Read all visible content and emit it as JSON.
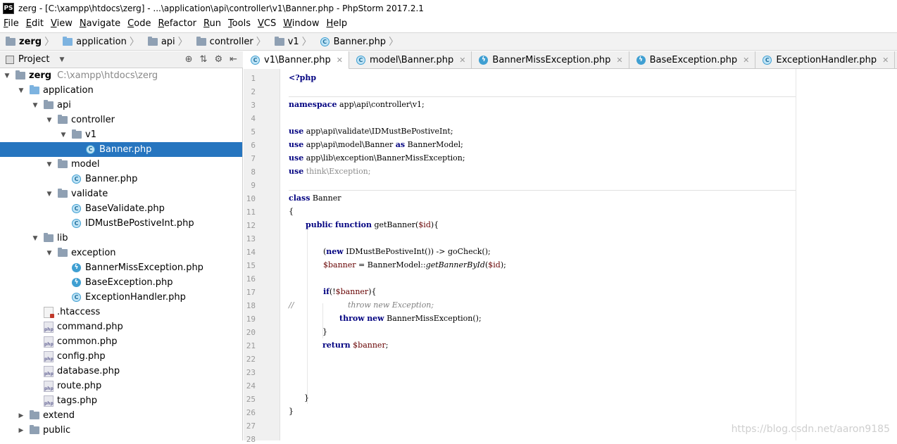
{
  "title_bar": {
    "logo": "PS",
    "title": "zerg - [C:\\xampp\\htdocs\\zerg] - ...\\application\\api\\controller\\v1\\Banner.php - PhpStorm 2017.2.1"
  },
  "menu": [
    {
      "label": "File",
      "u": "F",
      "rest": "ile"
    },
    {
      "label": "Edit",
      "u": "E",
      "rest": "dit"
    },
    {
      "label": "View",
      "u": "V",
      "rest": "iew"
    },
    {
      "label": "Navigate",
      "u": "N",
      "rest": "avigate"
    },
    {
      "label": "Code",
      "u": "C",
      "rest": "ode"
    },
    {
      "label": "Refactor",
      "u": "R",
      "rest": "efactor"
    },
    {
      "label": "Run",
      "u": "R",
      "rest": "un"
    },
    {
      "label": "Tools",
      "u": "T",
      "rest": "ools"
    },
    {
      "label": "VCS",
      "u": "V",
      "rest": "CS"
    },
    {
      "label": "Window",
      "u": "W",
      "rest": "indow"
    },
    {
      "label": "Help",
      "u": "H",
      "rest": "elp"
    }
  ],
  "breadcrumb": [
    "zerg",
    "application",
    "api",
    "controller",
    "v1",
    "Banner.php"
  ],
  "project_panel": {
    "label": "Project",
    "tools": [
      "⊕",
      "⇅",
      "⚙",
      "⇤"
    ]
  },
  "tree": [
    {
      "label": "zerg",
      "path": "C:\\xampp\\htdocs\\zerg",
      "depth": 0,
      "arrow": "▼",
      "icon": "folder"
    },
    {
      "label": "application",
      "depth": 1,
      "arrow": "▼",
      "icon": "folder-blue"
    },
    {
      "label": "api",
      "depth": 2,
      "arrow": "▼",
      "icon": "folder"
    },
    {
      "label": "controller",
      "depth": 3,
      "arrow": "▼",
      "icon": "folder"
    },
    {
      "label": "v1",
      "depth": 4,
      "arrow": "▼",
      "icon": "folder"
    },
    {
      "label": "Banner.php",
      "depth": 5,
      "arrow": "",
      "icon": "class",
      "selected": true
    },
    {
      "label": "model",
      "depth": 3,
      "arrow": "▼",
      "icon": "folder"
    },
    {
      "label": "Banner.php",
      "depth": 4,
      "arrow": "",
      "icon": "class"
    },
    {
      "label": "validate",
      "depth": 3,
      "arrow": "▼",
      "icon": "folder"
    },
    {
      "label": "BaseValidate.php",
      "depth": 4,
      "arrow": "",
      "icon": "class"
    },
    {
      "label": "IDMustBePostiveInt.php",
      "depth": 4,
      "arrow": "",
      "icon": "class"
    },
    {
      "label": "lib",
      "depth": 2,
      "arrow": "▼",
      "icon": "folder"
    },
    {
      "label": "exception",
      "depth": 3,
      "arrow": "▼",
      "icon": "folder"
    },
    {
      "label": "BannerMissException.php",
      "depth": 4,
      "arrow": "",
      "icon": "exception"
    },
    {
      "label": "BaseException.php",
      "depth": 4,
      "arrow": "",
      "icon": "exception"
    },
    {
      "label": "ExceptionHandler.php",
      "depth": 4,
      "arrow": "",
      "icon": "class"
    },
    {
      "label": ".htaccess",
      "depth": 2,
      "arrow": "",
      "icon": "htaccess"
    },
    {
      "label": "command.php",
      "depth": 2,
      "arrow": "",
      "icon": "php"
    },
    {
      "label": "common.php",
      "depth": 2,
      "arrow": "",
      "icon": "php"
    },
    {
      "label": "config.php",
      "depth": 2,
      "arrow": "",
      "icon": "php"
    },
    {
      "label": "database.php",
      "depth": 2,
      "arrow": "",
      "icon": "php"
    },
    {
      "label": "route.php",
      "depth": 2,
      "arrow": "",
      "icon": "php"
    },
    {
      "label": "tags.php",
      "depth": 2,
      "arrow": "",
      "icon": "php"
    },
    {
      "label": "extend",
      "depth": 1,
      "arrow": "▶",
      "icon": "folder"
    },
    {
      "label": "public",
      "depth": 1,
      "arrow": "▶",
      "icon": "folder"
    }
  ],
  "tabs": [
    {
      "label": "v1\\Banner.php",
      "icon": "class",
      "active": true
    },
    {
      "label": "model\\Banner.php",
      "icon": "class"
    },
    {
      "label": "BannerMissException.php",
      "icon": "exception"
    },
    {
      "label": "BaseException.php",
      "icon": "exception"
    },
    {
      "label": "ExceptionHandler.php",
      "icon": "class"
    }
  ],
  "code": {
    "line_numbers": [
      "1",
      "2",
      "3",
      "4",
      "5",
      "6",
      "7",
      "8",
      "9",
      "10",
      "11",
      "12",
      "13",
      "14",
      "15",
      "16",
      "17",
      "18",
      "19",
      "20",
      "21",
      "22",
      "23",
      "24",
      "25",
      "26",
      "27",
      "28"
    ],
    "l1": "<?php",
    "l3_kw": "namespace",
    "l3_rest": " app\\api\\controller\\v1;",
    "l5_kw": "use",
    "l5_rest": " app\\api\\validate\\IDMustBePostiveInt;",
    "l6_kw": "use",
    "l6_rest": " app\\api\\model\\Banner ",
    "l6_as": "as",
    "l6_tail": " BannerModel;",
    "l7_kw": "use",
    "l7_rest": " app\\lib\\exception\\BannerMissException;",
    "l8_kw": "use",
    "l8_rest": " think\\Exception;",
    "l10_kw": "class",
    "l10_rest": " Banner",
    "l11": "{",
    "l12_kw1": "public",
    "l12_kw2": "function",
    "l12_name": " getBanner(",
    "l12_var": "$id",
    "l12_tail": "){",
    "l14_open": "(",
    "l14_kw": "new",
    "l14_rest": " IDMustBePostiveInt()) -> goCheck();",
    "l15_var": "$banner",
    "l15_mid": " = BannerModel::",
    "l15_fn": "getBannerById",
    "l15_open": "(",
    "l15_var2": "$id",
    "l15_close": ");",
    "l17_kw": "if",
    "l17_open": "(!",
    "l17_var": "$banner",
    "l17_close": "){",
    "l18_cmt": "//",
    "l18_rest": "throw new Exception;",
    "l19_kw1": "throw",
    "l19_kw2": "new",
    "l19_rest": " BannerMissException();",
    "l20": "}",
    "l21_kw": "return",
    "l21_var": " $banner",
    "l21_tail": ";",
    "l25": "}",
    "l26": "}"
  },
  "watermark": "https://blog.csdn.net/aaron9185"
}
